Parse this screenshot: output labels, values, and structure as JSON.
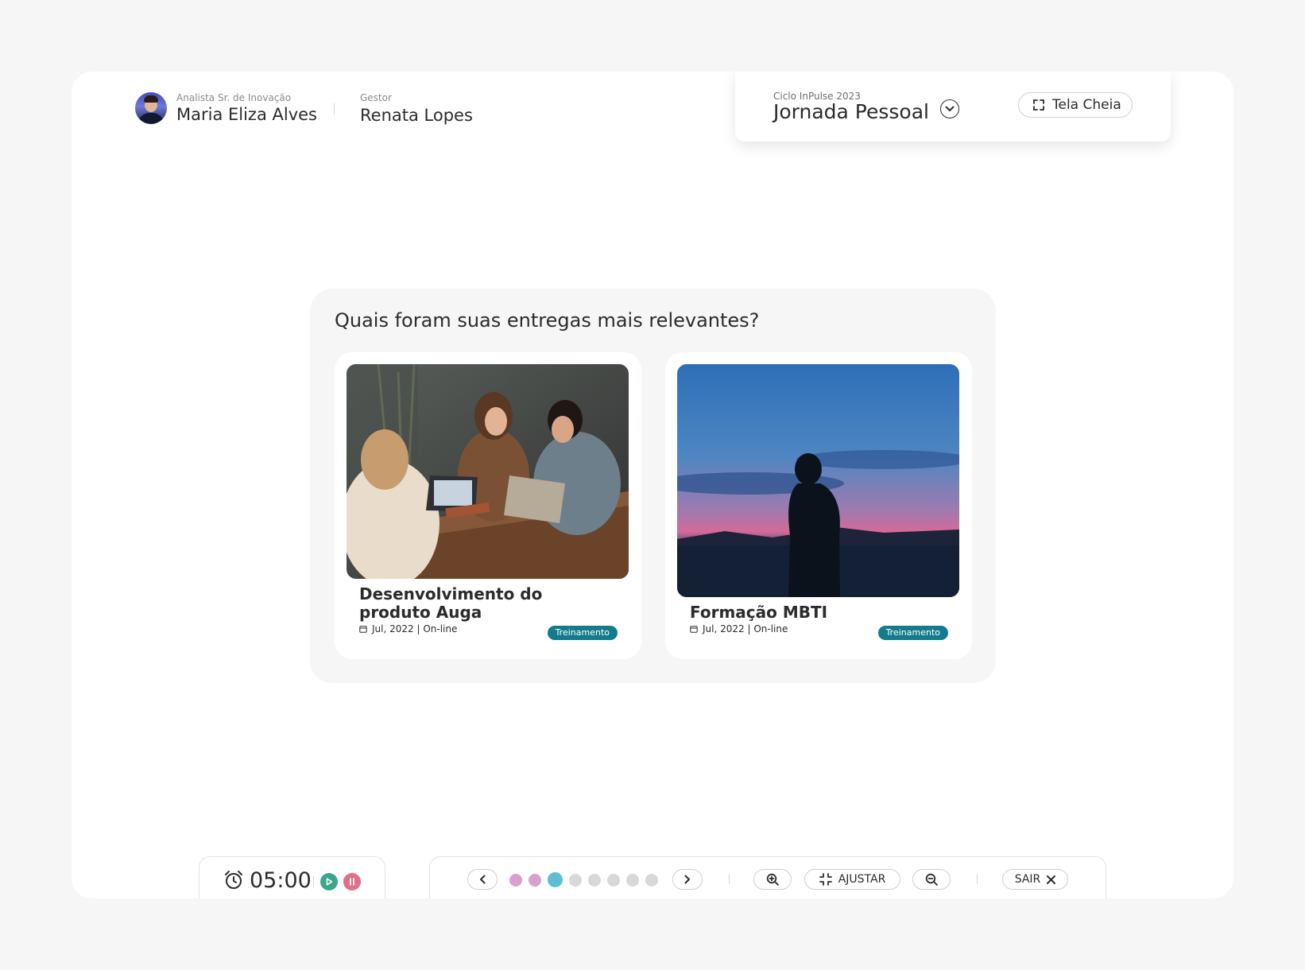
{
  "header": {
    "user": {
      "role": "Analista Sr. de Inovação",
      "name": "Maria Eliza Alves"
    },
    "manager": {
      "role": "Gestor",
      "name": "Renata Lopes"
    },
    "cycle": {
      "label": "Ciclo InPulse 2023",
      "title": "Jornada Pessoal"
    },
    "fullscreen_label": "Tela Cheia"
  },
  "question": {
    "title": "Quais foram suas entregas mais relevantes?",
    "items": [
      {
        "title": "Desenvolvimento do produto Auga",
        "meta": "Jul, 2022 | On-line",
        "badge": "Treinamento",
        "image": "meeting-photo"
      },
      {
        "title": "Formação MBTI",
        "meta": "Jul, 2022 | On-line",
        "badge": "Treinamento",
        "image": "sunset-silhouette-photo"
      }
    ]
  },
  "timer": {
    "time": "05:00"
  },
  "navigation": {
    "adjust_label": "AJUSTAR",
    "exit_label": "SAIR",
    "steps": [
      "visited",
      "visited",
      "current",
      "pending",
      "pending",
      "pending",
      "pending",
      "pending"
    ]
  },
  "colors": {
    "accent_teal": "#137b8c",
    "step_current": "#5cbfd1",
    "step_visited": "#d9a0cf",
    "step_pending": "#d8d8d8",
    "play": "#3aa68f",
    "pause": "#e07086"
  }
}
